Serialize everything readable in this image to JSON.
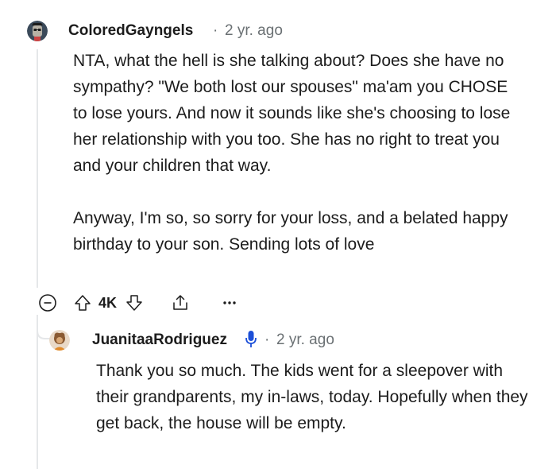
{
  "comment": {
    "username": "ColoredGayngels",
    "separator": "·",
    "time": "2 yr. ago",
    "paragraphs": [
      "NTA, what the hell is she talking about? Does she have no sympathy? \"We both lost our spouses\" ma'am you CHOSE to lose yours. And now it sounds like she's choosing to lose her relationship with you too. She has no right to treat you and your children that way.",
      "Anyway, I'm so, so sorry for your loss, and a belated happy birthday to your son. Sending lots of love"
    ],
    "vote_count": "4K",
    "icons": [
      "collapse-icon",
      "upvote-icon",
      "downvote-icon",
      "share-icon",
      "more-options-icon"
    ]
  },
  "reply": {
    "username": "JuanitaaRodriguez",
    "separator": "·",
    "time": "2 yr. ago",
    "text": "Thank you so much. The kids went for a sleepover with their grandparents, my in-laws, today. Hopefully when they get back, the house will be empty.",
    "icons": [
      "microphone-icon"
    ]
  },
  "colors": {
    "text": "#1c1c1c",
    "meta": "#6a7073",
    "thread_line": "#e5e7e9",
    "mic_blue": "#1c4fd8"
  }
}
